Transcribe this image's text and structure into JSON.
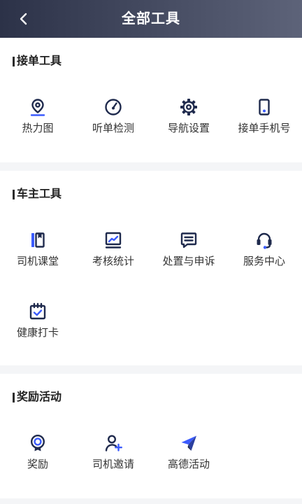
{
  "header": {
    "title": "全部工具",
    "back_icon": "chevron-left-icon"
  },
  "sections": [
    {
      "title": "接单工具",
      "items": [
        {
          "label": "热力图",
          "icon": "location-pin-icon"
        },
        {
          "label": "听单检测",
          "icon": "gauge-icon"
        },
        {
          "label": "导航设置",
          "icon": "gear-icon"
        },
        {
          "label": "接单手机号",
          "icon": "phone-icon"
        }
      ]
    },
    {
      "title": "车主工具",
      "items": [
        {
          "label": "司机课堂",
          "icon": "book-icon"
        },
        {
          "label": "考核统计",
          "icon": "chart-icon"
        },
        {
          "label": "处置与申诉",
          "icon": "message-icon"
        },
        {
          "label": "服务中心",
          "icon": "headset-icon"
        },
        {
          "label": "健康打卡",
          "icon": "calendar-check-icon"
        }
      ]
    },
    {
      "title": "奖励活动",
      "items": [
        {
          "label": "奖励",
          "icon": "medal-icon"
        },
        {
          "label": "司机邀请",
          "icon": "user-plus-icon"
        },
        {
          "label": "高德活动",
          "icon": "paper-plane-icon"
        }
      ]
    }
  ],
  "colors": {
    "header_gradient_start": "#2c3248",
    "header_gradient_end": "#5d6379",
    "icon_dark": "#1f2a4d",
    "icon_accent": "#3b5bfd",
    "divider": "#f4f5f7"
  }
}
